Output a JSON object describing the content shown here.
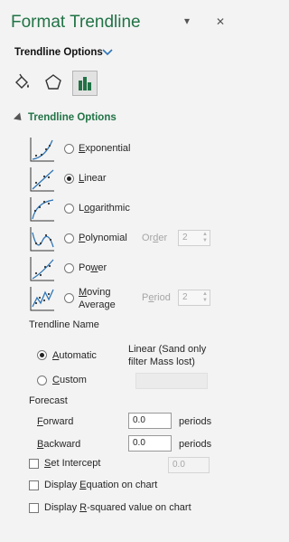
{
  "pane": {
    "title": "Format Trendline",
    "dropdown_icon": "chevron-down-icon",
    "close_icon": "close-icon",
    "close_glyph": "✕",
    "dropdown_glyph": "▾"
  },
  "tabs": {
    "label": "Trendline Options",
    "icons": [
      "paint-bucket-icon",
      "pentagon-icon",
      "bar-chart-icon"
    ],
    "selected": "bar-chart-icon"
  },
  "section": {
    "title": "Trendline Options",
    "expanded": true
  },
  "types": [
    {
      "id": "exponential",
      "pre": "",
      "u": "E",
      "post": "xponential",
      "selected": false
    },
    {
      "id": "linear",
      "pre": "",
      "u": "L",
      "post": "inear",
      "selected": true
    },
    {
      "id": "logarithmic",
      "pre": "L",
      "u": "o",
      "post": "garithmic",
      "selected": false
    },
    {
      "id": "polynomial",
      "pre": "",
      "u": "P",
      "post": "olynomial",
      "selected": false
    },
    {
      "id": "power",
      "pre": "Po",
      "u": "w",
      "post": "er",
      "selected": false
    },
    {
      "id": "moving-average",
      "pre": "",
      "u": "M",
      "post": "oving",
      "line2": "Average",
      "selected": false
    }
  ],
  "order": {
    "pre": "Or",
    "u": "d",
    "post": "er",
    "value": "2"
  },
  "period": {
    "pre": "P",
    "u": "e",
    "post": "riod",
    "value": "2"
  },
  "name": {
    "heading": "Trendline Name",
    "automatic": {
      "pre": "",
      "u": "A",
      "post": "utomatic",
      "selected": true
    },
    "automatic_value": "Linear (Sand only filter Mass lost)",
    "custom": {
      "pre": "",
      "u": "C",
      "post": "ustom",
      "selected": false
    },
    "custom_value": ""
  },
  "forecast": {
    "heading": "Forecast",
    "forward": {
      "pre": "",
      "u": "F",
      "post": "orward",
      "value": "0.0",
      "unit": "periods"
    },
    "backward": {
      "pre": "",
      "u": "B",
      "post": "ackward",
      "value": "0.0",
      "unit": "periods"
    }
  },
  "options": {
    "set_intercept": {
      "pre": "",
      "u": "S",
      "post": "et Intercept",
      "checked": false,
      "value": "0.0"
    },
    "display_equation": {
      "pre": "Display ",
      "u": "E",
      "post": "quation on chart",
      "checked": false
    },
    "display_r2": {
      "pre": "Display ",
      "u": "R",
      "post": "-squared value on chart",
      "checked": false
    }
  },
  "colors": {
    "accent": "#217346",
    "background": "#f3f3f3",
    "trendline_blue": "#2e75b6"
  }
}
